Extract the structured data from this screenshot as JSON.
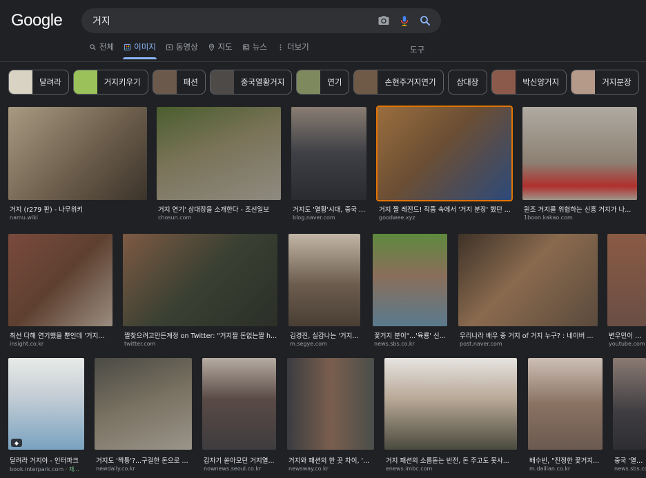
{
  "logo": "Google",
  "search": {
    "query": "거지",
    "camera_icon": "camera-icon",
    "mic_icon": "mic-icon",
    "search_icon": "search-icon"
  },
  "tabs": [
    {
      "label": "전체",
      "icon": "search-icon",
      "active": false
    },
    {
      "label": "이미지",
      "icon": "image-icon",
      "active": true
    },
    {
      "label": "동영상",
      "icon": "video-icon",
      "active": false
    },
    {
      "label": "지도",
      "icon": "map-pin-icon",
      "active": false
    },
    {
      "label": "뉴스",
      "icon": "news-icon",
      "active": false
    },
    {
      "label": "더보기",
      "icon": "more-vert-icon",
      "active": false
    }
  ],
  "tools_label": "도구",
  "chips": [
    {
      "label": "달려라",
      "thumb_color": "#d9d3c4"
    },
    {
      "label": "거지키우기",
      "thumb_color": "#9bc25a"
    },
    {
      "label": "패션",
      "thumb_color": "#6b5a4c"
    },
    {
      "label": "중국열황거지",
      "thumb_color": "#4d4a48"
    },
    {
      "label": "연기",
      "thumb_color": "#7e8a5e"
    },
    {
      "label": "손현주거지연기",
      "thumb_color": "#6f5a48"
    },
    {
      "label": "삼대장",
      "thumb_color": ""
    },
    {
      "label": "박신양거지",
      "thumb_color": "#8c5a4a"
    },
    {
      "label": "거지분장",
      "thumb_color": "#b59a8a"
    }
  ],
  "results": [
    {
      "caption": "거지 (r279 판) - 나무위키",
      "source": "namu.wiki",
      "color": "#8a7a66"
    },
    {
      "caption": "거지 연기' 삼대장을 소개한다 - 조선일보",
      "source": "chosun.com",
      "color": "#7e7a60"
    },
    {
      "caption": "거지도 '열황'시대, 중국 ...",
      "source": "blog.naver.com",
      "color": "#4e4d52"
    },
    {
      "caption": "거지 짤 레전드! 작품 속에서 '거지 분장' 했던 ...",
      "source": "goodwee.xyz",
      "color": "#6b5a42"
    },
    {
      "caption": "원조 거지를 위협하는 신흥 거지가 나...",
      "source": "1boon.kakao.com",
      "color": "#93887a"
    },
    {
      "caption": "최선 다해 연기했을 뿐인데 '거지...",
      "source": "insight.co.kr",
      "color": "#6a5044"
    },
    {
      "caption": "짤찾으려고만든계정 on Twitter: \"거지짤 돈없는짤 h...",
      "source": "twitter.com",
      "color": "#4b4e3c"
    },
    {
      "caption": "김경진, 실감나는 '거지' ...",
      "source": "m.segye.com",
      "color": "#7d6a5a"
    },
    {
      "caption": "꽃거지 분이\"...'육룡' 신...",
      "source": "news.sbs.co.kr",
      "color": "#5f6a4a"
    },
    {
      "caption": "우리나라 배우 중 거지 of 거지 누구? : 네이버 ...",
      "source": "post.naver.com",
      "color": "#5b4a3c"
    },
    {
      "caption": "변우민이 직접",
      "source": "youtube.com",
      "color": "#6a4e44"
    },
    {
      "caption": "달려라 거지야 - 인터파크",
      "source": "book.interpark.com",
      "source_extra": "· 재...",
      "color": "#cdd3d8"
    },
    {
      "caption": "거지도 '짝퉁'?...구걸한 돈으로 ...",
      "source": "newdaily.co.kr",
      "color": "#6e6a60"
    },
    {
      "caption": "갑자기 쏟아모던 거지열...",
      "source": "nownews.seoul.co.kr",
      "color": "#5c5a58"
    },
    {
      "caption": "거지와 패션의 한 끗 차이, '...",
      "source": "newsway.co.kr",
      "color": "#4e4a46"
    },
    {
      "caption": "거지 패션의 소름돋는 반전, 돈 주고도 못사...",
      "source": "enews.imbc.com",
      "color": "#5e5a50"
    },
    {
      "caption": "배수빈, \"진정한 꽃거지...",
      "source": "m.dailian.co.kr",
      "color": "#7a6a5e"
    },
    {
      "caption": "중국 '열황거",
      "source": "news.sbs.co",
      "color": "#4e4c4e"
    }
  ]
}
